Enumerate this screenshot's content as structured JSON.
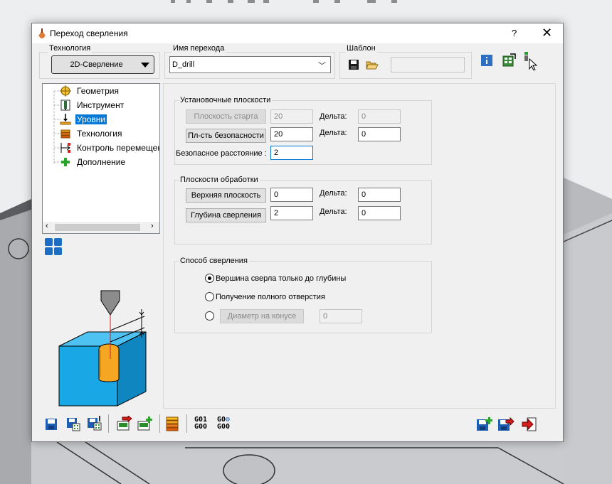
{
  "window": {
    "title": "Переход сверления",
    "help_glyph": "?",
    "close_glyph": "✕"
  },
  "header": {
    "technology_label": "Технология",
    "technology_value": "2D-Сверление",
    "name_label": "Имя перехода",
    "name_value": "D_drill",
    "template_label": "Шаблон",
    "template_value": ""
  },
  "tree": {
    "items": [
      {
        "label": "Геометрия",
        "icon": "crosshair-icon"
      },
      {
        "label": "Инструмент",
        "icon": "tool-icon"
      },
      {
        "label": "Уровни",
        "icon": "levels-icon",
        "selected": true
      },
      {
        "label": "Технология",
        "icon": "layers-icon"
      },
      {
        "label": "Контроль перемещен",
        "icon": "movement-icon"
      },
      {
        "label": "Дополнение",
        "icon": "plus-icon"
      }
    ]
  },
  "setup_planes": {
    "title": "Установочные плоскости",
    "start_plane_button": "Плоскость старта",
    "start_plane_value": "20",
    "start_delta_label": "Дельта:",
    "start_delta_value": "0",
    "safety_plane_button": "Пл-сть безопасности",
    "safety_plane_value": "20",
    "safety_delta_label": "Дельта:",
    "safety_delta_value": "0",
    "safe_distance_label": "Безопасное расстояние :",
    "safe_distance_value": "2"
  },
  "machining_planes": {
    "title": "Плоскости обработки",
    "upper_plane_button": "Верхняя плоскость",
    "upper_plane_value": "0",
    "upper_delta_label": "Дельта:",
    "upper_delta_value": "0",
    "drill_depth_button": "Глубина сверления",
    "drill_depth_value": "2",
    "depth_delta_label": "Дельта:",
    "depth_delta_value": "0"
  },
  "drill_method": {
    "title": "Способ сверления",
    "option1": "Вершина сверла только до глубины",
    "option2": "Получение полного отверстия",
    "option3_button": "Диаметр на конусе",
    "option3_value": "0",
    "selected": 1
  },
  "bottom_toolbar": {
    "gcode1_top": "G01",
    "gcode1_bottom": "G00",
    "gcode2_top": "G0",
    "gcode2_bottom": "G00"
  },
  "colors": {
    "accent": "#0078d7",
    "part_blue": "#1aa7e6",
    "hole_orange": "#f5a623"
  }
}
